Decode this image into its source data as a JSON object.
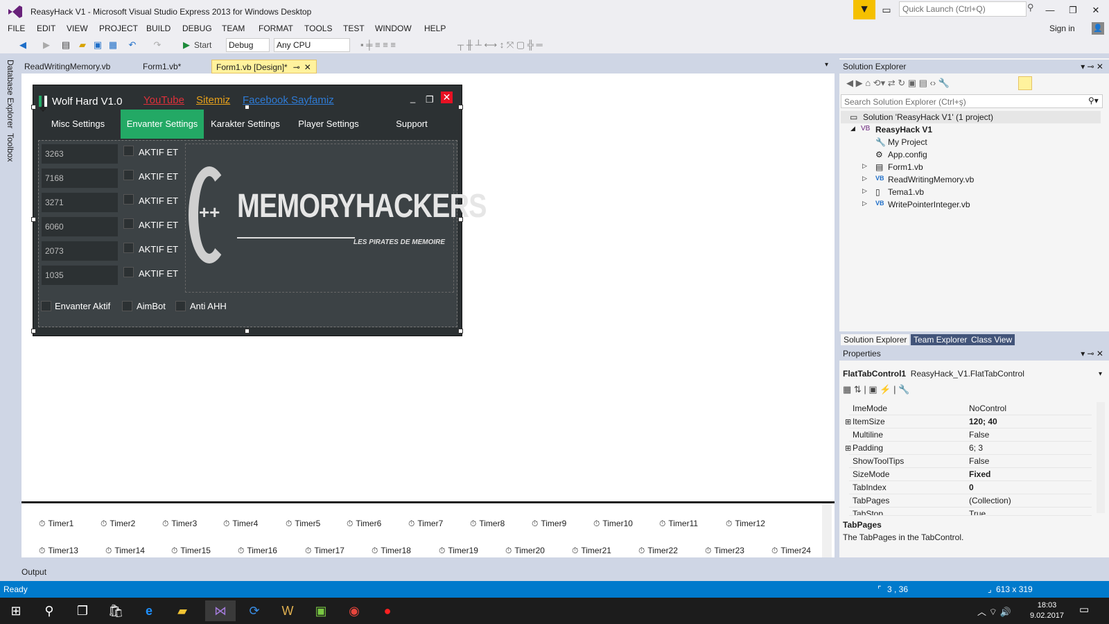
{
  "window": {
    "title": "ReasyHack V1 - Microsoft Visual Studio Express 2013 for Windows Desktop",
    "quick_launch_placeholder": "Quick Launch (Ctrl+Q)",
    "sign_in": "Sign in"
  },
  "menu": [
    "FILE",
    "EDIT",
    "VIEW",
    "PROJECT",
    "BUILD",
    "DEBUG",
    "TEAM",
    "FORMAT",
    "TOOLS",
    "TEST",
    "WINDOW",
    "HELP"
  ],
  "toolbar": {
    "start": "Start",
    "config": "Debug",
    "platform": "Any CPU"
  },
  "left_tabs": [
    "Database Explorer",
    "Toolbox"
  ],
  "doc_tabs": [
    "ReadWritingMemory.vb",
    "Form1.vb*",
    "Form1.vb [Design]*"
  ],
  "form": {
    "title": "Wolf Hard V1.0",
    "links": [
      "YouTube",
      "Sitemiz",
      "Facebook Sayfamiz"
    ],
    "tabs": [
      "Misc Settings",
      "Envanter Settings",
      "Karakter Settings",
      "Player Settings",
      "Support"
    ],
    "values": [
      "3263",
      "7168",
      "3271",
      "6060",
      "2073",
      "1035"
    ],
    "aktif": "AKTIF ET",
    "bottom_checks": [
      "Envanter Aktif",
      "AimBot",
      "Anti AHH"
    ],
    "logo_main": "MEMORYHACKERS",
    "logo_sub": "LES PIRATES DE MEMOIRE",
    "logo_plus": "++"
  },
  "timers_row1": [
    "Timer1",
    "Timer2",
    "Timer3",
    "Timer4",
    "Timer5",
    "Timer6",
    "Timer7",
    "Timer8",
    "Timer9",
    "Timer10",
    "Timer11",
    "Timer12"
  ],
  "timers_row2": [
    "Timer13",
    "Timer14",
    "Timer15",
    "Timer16",
    "Timer17",
    "Timer18",
    "Timer19",
    "Timer20",
    "Timer21",
    "Timer22",
    "Timer23",
    "Timer24"
  ],
  "output_label": "Output",
  "status": {
    "text": "Ready",
    "position": "3 , 36",
    "size": "613 x 319"
  },
  "solution_explorer": {
    "title": "Solution Explorer",
    "search_placeholder": "Search Solution Explorer (Ctrl+ş)",
    "solution": "Solution 'ReasyHack V1' (1 project)",
    "project": "ReasyHack V1",
    "items": [
      "My Project",
      "App.config",
      "Form1.vb",
      "ReadWritingMemory.vb",
      "Tema1.vb",
      "WritePointerInteger.vb"
    ],
    "tabs": [
      "Solution Explorer",
      "Team Explorer",
      "Class View"
    ]
  },
  "properties": {
    "title": "Properties",
    "object_name": "FlatTabControl1",
    "object_type": "ReasyHack_V1.FlatTabControl",
    "rows": [
      {
        "name": "ImeMode",
        "value": "NoControl"
      },
      {
        "name": "ItemSize",
        "value": "120; 40"
      },
      {
        "name": "Multiline",
        "value": "False"
      },
      {
        "name": "Padding",
        "value": "6; 3"
      },
      {
        "name": "ShowToolTips",
        "value": "False"
      },
      {
        "name": "SizeMode",
        "value": "Fixed"
      },
      {
        "name": "TabIndex",
        "value": "0"
      },
      {
        "name": "TabPages",
        "value": "(Collection)"
      },
      {
        "name": "TabStop",
        "value": "True"
      }
    ],
    "desc_title": "TabPages",
    "desc_text": "The TabPages in the TabControl."
  },
  "taskbar": {
    "time": "18:03",
    "date": "9.02.2017"
  },
  "colors": {
    "accent": "#007acc",
    "active_tab": "#23a965",
    "notify": "#f5c000",
    "close": "#e81123"
  }
}
